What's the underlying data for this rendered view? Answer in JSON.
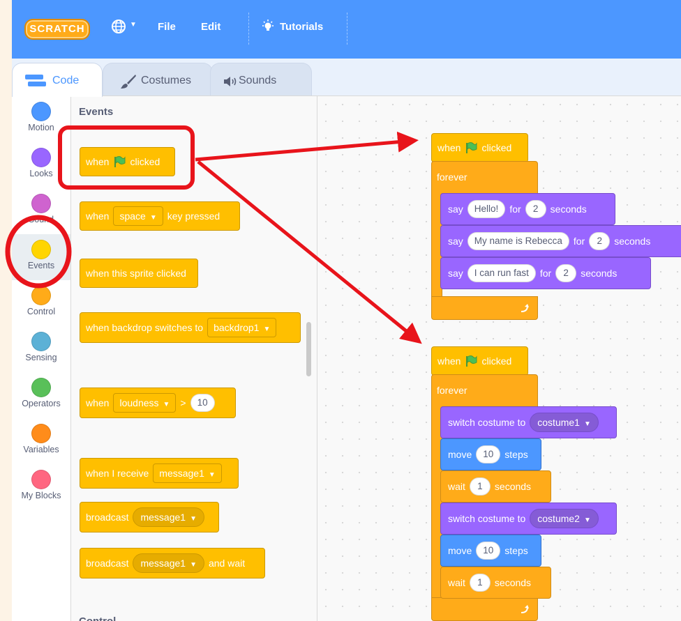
{
  "menubar": {
    "logo_text": "SCRATCH",
    "file": "File",
    "edit": "Edit",
    "tutorials": "Tutorials"
  },
  "tabs": [
    {
      "label": "Code",
      "active": true
    },
    {
      "label": "Costumes",
      "active": false
    },
    {
      "label": "Sounds",
      "active": false
    }
  ],
  "categories": [
    {
      "label": "Motion",
      "color": "#4c97ff"
    },
    {
      "label": "Looks",
      "color": "#9966ff"
    },
    {
      "label": "Sound",
      "color": "#cf63cf"
    },
    {
      "label": "Events",
      "color": "#ffd500",
      "selected": true
    },
    {
      "label": "Control",
      "color": "#ffab19"
    },
    {
      "label": "Sensing",
      "color": "#5cb1d6"
    },
    {
      "label": "Operators",
      "color": "#59c059"
    },
    {
      "label": "Variables",
      "color": "#ff8c1a"
    },
    {
      "label": "My Blocks",
      "color": "#ff6680"
    }
  ],
  "palette": {
    "heading": "Events",
    "next_heading": "Control",
    "when_flag": {
      "when": "when",
      "clicked": "clicked"
    },
    "key_pressed": {
      "when": "when",
      "key": "space",
      "rest": "key pressed"
    },
    "sprite_clicked": "when this sprite clicked",
    "backdrop_switch": {
      "text": "when backdrop switches to",
      "value": "backdrop1"
    },
    "loudness": {
      "when": "when",
      "sensor": "loudness",
      "op": ">",
      "value": "10"
    },
    "receive": {
      "text": "when I receive",
      "value": "message1"
    },
    "broadcast": {
      "text": "broadcast",
      "value": "message1"
    },
    "broadcast_wait": {
      "text": "broadcast",
      "value": "message1",
      "rest": "and wait"
    }
  },
  "script1": {
    "hat": {
      "when": "when",
      "clicked": "clicked"
    },
    "forever": "forever",
    "says": [
      {
        "say": "say",
        "msg": "Hello!",
        "for": "for",
        "secs": "2",
        "unit": "seconds"
      },
      {
        "say": "say",
        "msg": "My name is Rebecca",
        "for": "for",
        "secs": "2",
        "unit": "seconds"
      },
      {
        "say": "say",
        "msg": "I can run fast",
        "for": "for",
        "secs": "2",
        "unit": "seconds"
      }
    ]
  },
  "script2": {
    "hat": {
      "when": "when",
      "clicked": "clicked"
    },
    "forever": "forever",
    "switch1": {
      "text": "switch costume to",
      "value": "costume1"
    },
    "move1": {
      "move": "move",
      "steps_val": "10",
      "steps": "steps"
    },
    "wait1": {
      "wait": "wait",
      "val": "1",
      "unit": "seconds"
    },
    "switch2": {
      "text": "switch costume to",
      "value": "costume2"
    },
    "move2": {
      "move": "move",
      "steps_val": "10",
      "steps": "steps"
    },
    "wait2": {
      "wait": "wait",
      "val": "1",
      "unit": "seconds"
    }
  },
  "annotation_color": "#e8141b"
}
